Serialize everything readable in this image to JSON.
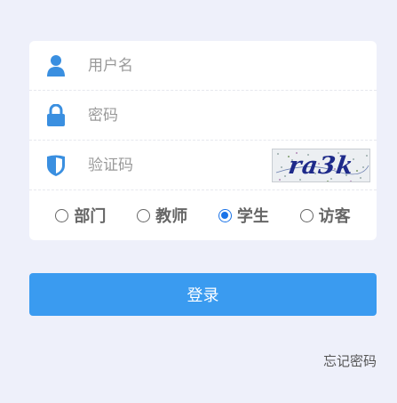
{
  "form": {
    "username_placeholder": "用户名",
    "password_placeholder": "密码",
    "captcha_placeholder": "验证码",
    "captcha_text": "ra3k"
  },
  "icons": {
    "username": "user-icon",
    "password": "lock-icon",
    "captcha": "shield-icon"
  },
  "roles": [
    {
      "label": "部门",
      "checked": false
    },
    {
      "label": "教师",
      "checked": false
    },
    {
      "label": "学生",
      "checked": true
    },
    {
      "label": "访客",
      "checked": false
    }
  ],
  "login_label": "登录",
  "forgot_label": "忘记密码",
  "colors": {
    "accent": "#3a9bf0",
    "background": "#eef0fa",
    "icon": "#3a8fe0"
  }
}
